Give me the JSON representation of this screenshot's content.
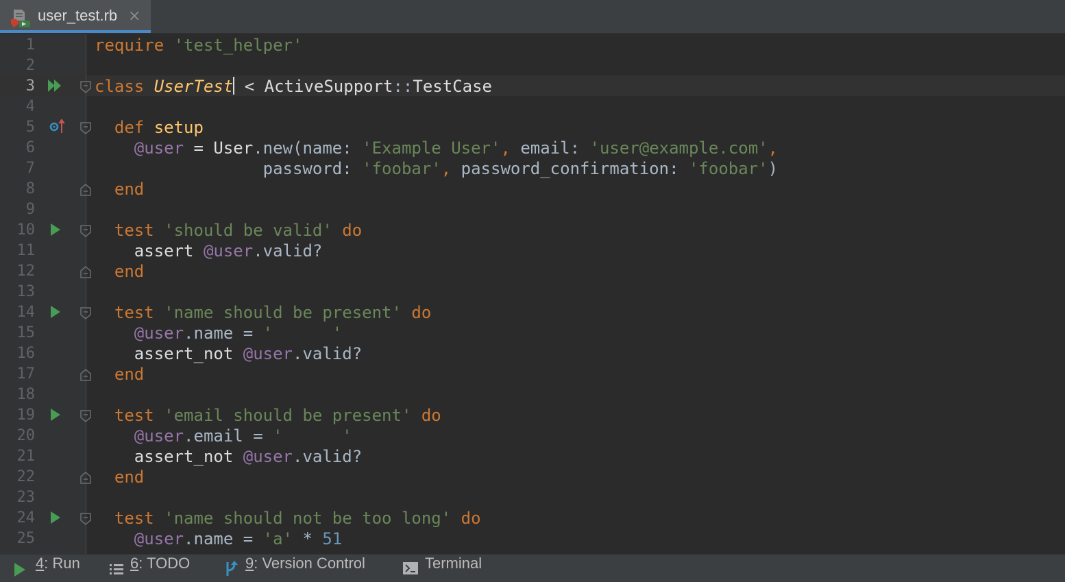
{
  "tab": {
    "label": "user_test.rb",
    "close": "×",
    "icon": "ruby-test-file-icon"
  },
  "editor": {
    "lines": [
      {
        "n": "1",
        "tokens": [
          [
            "kw",
            "require "
          ],
          [
            "st",
            "'test_helper'"
          ]
        ]
      },
      {
        "n": "2",
        "tokens": []
      },
      {
        "n": "3",
        "tokens": [
          [
            "kw",
            "class "
          ],
          [
            "cls",
            "UserTest"
          ],
          [
            "caret",
            ""
          ],
          [
            "cn",
            " < ActiveSupport"
          ],
          [
            "tx",
            "::"
          ],
          [
            "cn",
            "TestCase"
          ]
        ]
      },
      {
        "n": "4",
        "tokens": []
      },
      {
        "n": "5",
        "tokens": [
          [
            "tx",
            "  "
          ],
          [
            "kw",
            "def "
          ],
          [
            "cls2",
            "setup"
          ]
        ]
      },
      {
        "n": "6",
        "tokens": [
          [
            "tx",
            "    "
          ],
          [
            "iv",
            "@user"
          ],
          [
            "cn",
            " = User"
          ],
          [
            "tx",
            ".new(name: "
          ],
          [
            "st",
            "'Example User'"
          ],
          [
            "kw",
            ", "
          ],
          [
            "tx",
            "email: "
          ],
          [
            "st",
            "'user@example.com'"
          ],
          [
            "kw",
            ","
          ]
        ]
      },
      {
        "n": "7",
        "tokens": [
          [
            "tx",
            "                 password: "
          ],
          [
            "st",
            "'foobar'"
          ],
          [
            "kw",
            ", "
          ],
          [
            "tx",
            "password_confirmation: "
          ],
          [
            "st",
            "'foobar'"
          ],
          [
            "tx",
            ")"
          ]
        ]
      },
      {
        "n": "8",
        "tokens": [
          [
            "tx",
            "  "
          ],
          [
            "kw",
            "end"
          ]
        ]
      },
      {
        "n": "9",
        "tokens": []
      },
      {
        "n": "10",
        "tokens": [
          [
            "tx",
            "  "
          ],
          [
            "kw",
            "test "
          ],
          [
            "st",
            "'should be valid'"
          ],
          [
            "kw",
            " do"
          ]
        ]
      },
      {
        "n": "11",
        "tokens": [
          [
            "tx",
            "    "
          ],
          [
            "cn",
            "assert "
          ],
          [
            "iv",
            "@user"
          ],
          [
            "tx",
            ".valid?"
          ]
        ]
      },
      {
        "n": "12",
        "tokens": [
          [
            "tx",
            "  "
          ],
          [
            "kw",
            "end"
          ]
        ]
      },
      {
        "n": "13",
        "tokens": []
      },
      {
        "n": "14",
        "tokens": [
          [
            "tx",
            "  "
          ],
          [
            "kw",
            "test "
          ],
          [
            "st",
            "'name should be present'"
          ],
          [
            "kw",
            " do"
          ]
        ]
      },
      {
        "n": "15",
        "tokens": [
          [
            "tx",
            "    "
          ],
          [
            "iv",
            "@user"
          ],
          [
            "tx",
            ".name = "
          ],
          [
            "st",
            "'      '"
          ]
        ]
      },
      {
        "n": "16",
        "tokens": [
          [
            "tx",
            "    "
          ],
          [
            "cn",
            "assert_not "
          ],
          [
            "iv",
            "@user"
          ],
          [
            "tx",
            ".valid?"
          ]
        ]
      },
      {
        "n": "17",
        "tokens": [
          [
            "tx",
            "  "
          ],
          [
            "kw",
            "end"
          ]
        ]
      },
      {
        "n": "18",
        "tokens": []
      },
      {
        "n": "19",
        "tokens": [
          [
            "tx",
            "  "
          ],
          [
            "kw",
            "test "
          ],
          [
            "st",
            "'email should be present'"
          ],
          [
            "kw",
            " do"
          ]
        ]
      },
      {
        "n": "20",
        "tokens": [
          [
            "tx",
            "    "
          ],
          [
            "iv",
            "@user"
          ],
          [
            "tx",
            ".email = "
          ],
          [
            "st",
            "'      '"
          ]
        ]
      },
      {
        "n": "21",
        "tokens": [
          [
            "tx",
            "    "
          ],
          [
            "cn",
            "assert_not "
          ],
          [
            "iv",
            "@user"
          ],
          [
            "tx",
            ".valid?"
          ]
        ]
      },
      {
        "n": "22",
        "tokens": [
          [
            "tx",
            "  "
          ],
          [
            "kw",
            "end"
          ]
        ]
      },
      {
        "n": "23",
        "tokens": []
      },
      {
        "n": "24",
        "tokens": [
          [
            "tx",
            "  "
          ],
          [
            "kw",
            "test "
          ],
          [
            "st",
            "'name should not be too long'"
          ],
          [
            "kw",
            " do"
          ]
        ]
      },
      {
        "n": "25",
        "tokens": [
          [
            "tx",
            "    "
          ],
          [
            "iv",
            "@user"
          ],
          [
            "tx",
            ".name = "
          ],
          [
            "st",
            "'a'"
          ],
          [
            "tx",
            " * "
          ],
          [
            "nm",
            "51"
          ]
        ]
      }
    ],
    "current_line": "3"
  },
  "statusbar": {
    "run": {
      "key": "4",
      "label": ": Run"
    },
    "todo": {
      "key": "6",
      "label": ": TODO"
    },
    "vcs": {
      "key": "9",
      "label": ": Version Control"
    },
    "terminal": {
      "label": "Terminal"
    }
  }
}
